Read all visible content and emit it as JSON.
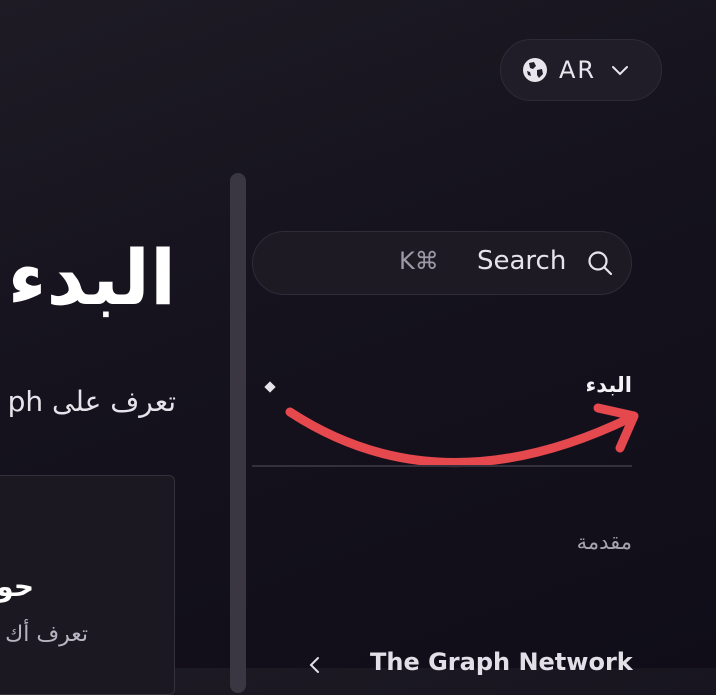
{
  "language_selector": {
    "code": "AR",
    "icon": "globe-icon"
  },
  "search": {
    "label": "Search",
    "shortcut": "K⌘",
    "icon": "search-icon"
  },
  "main": {
    "title": "البدء",
    "subtitle": "تعرف على ph",
    "card": {
      "title": "حو",
      "description": "تعرف أك"
    }
  },
  "sidebar": {
    "active_item": "البدء",
    "section_label": "مقدمة",
    "items": [
      {
        "label": "The Graph Network"
      }
    ]
  },
  "annotation": {
    "color": "#e5484d"
  }
}
